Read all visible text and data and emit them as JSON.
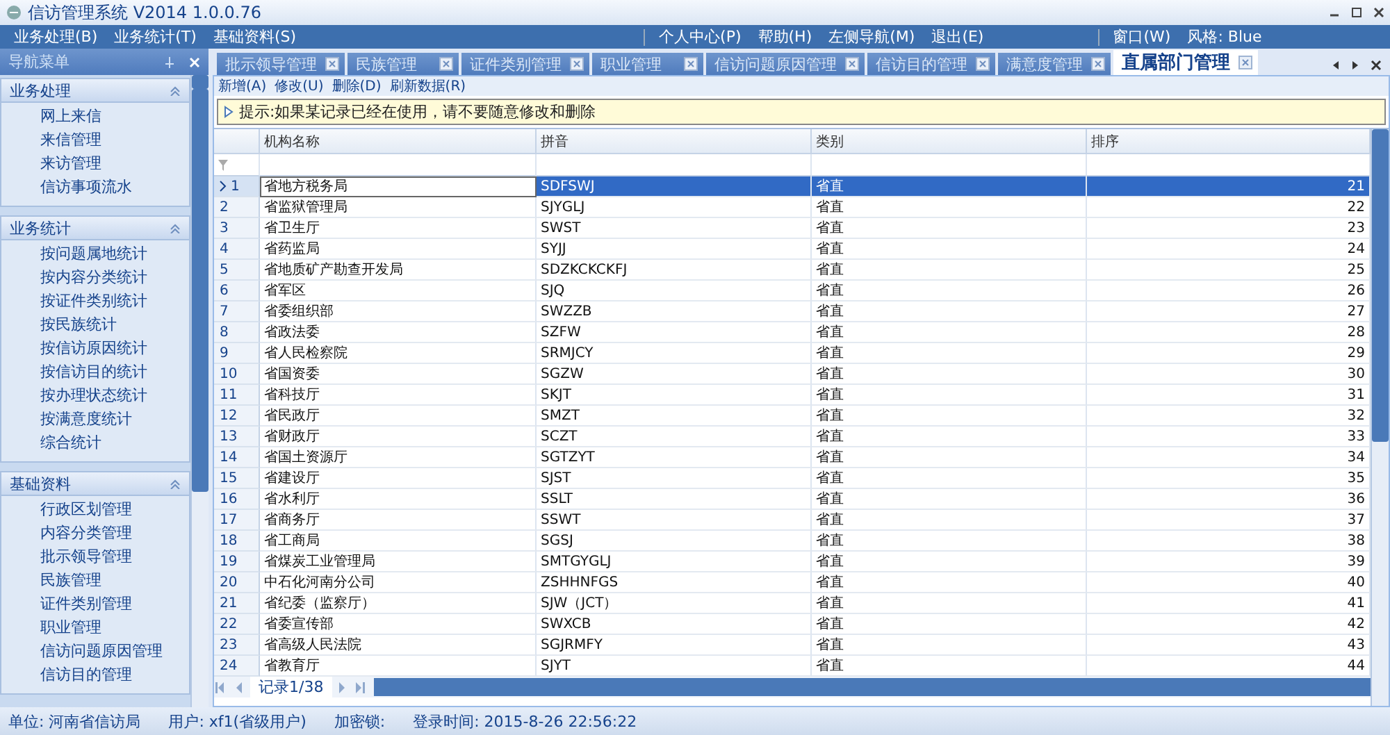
{
  "window": {
    "title": "信访管理系统 V2014 1.0.0.76"
  },
  "menu": {
    "left": [
      "业务处理(B)",
      "业务统计(T)",
      "基础资料(S)"
    ],
    "right": [
      "个人中心(P)",
      "帮助(H)",
      "左侧导航(M)",
      "退出(E)"
    ],
    "extra": [
      "窗口(W)",
      "风格: Blue"
    ]
  },
  "sidebar": {
    "title": "导航菜单",
    "groups": [
      {
        "title": "业务处理",
        "expanded": true,
        "items": [
          "网上来信",
          "来信管理",
          "来访管理",
          "信访事项流水"
        ]
      },
      {
        "title": "业务统计",
        "expanded": true,
        "items": [
          "按问题属地统计",
          "按内容分类统计",
          "按证件类别统计",
          "按民族统计",
          "按信访原因统计",
          "按信访目的统计",
          "按办理状态统计",
          "按满意度统计",
          "综合统计"
        ]
      },
      {
        "title": "基础资料",
        "expanded": true,
        "items": [
          "行政区划管理",
          "内容分类管理",
          "批示领导管理",
          "民族管理",
          "证件类别管理",
          "职业管理",
          "信访问题原因管理",
          "信访目的管理"
        ]
      }
    ]
  },
  "tabs": [
    {
      "label": "批示领导管理",
      "selected": false
    },
    {
      "label": "民族管理",
      "selected": false
    },
    {
      "label": "证件类别管理",
      "selected": false
    },
    {
      "label": "职业管理",
      "selected": false
    },
    {
      "label": "信访问题原因管理",
      "selected": false
    },
    {
      "label": "信访目的管理",
      "selected": false
    },
    {
      "label": "满意度管理",
      "selected": false
    },
    {
      "label": "直属部门管理",
      "selected": true
    }
  ],
  "toolbar": [
    "新增(A)",
    "修改(U)",
    "删除(D)",
    "刷新数据(R)"
  ],
  "hint": "提示:如果某记录已经在使用，请不要随意修改和删除",
  "table": {
    "columns": [
      "机构名称",
      "拼音",
      "类别",
      "排序"
    ],
    "rows": [
      {
        "num": "1",
        "selected": true,
        "cells": [
          "省地方税务局",
          "SDFSWJ",
          "省直",
          "21"
        ]
      },
      {
        "num": "2",
        "selected": false,
        "cells": [
          "省监狱管理局",
          "SJYGLJ",
          "省直",
          "22"
        ]
      },
      {
        "num": "3",
        "selected": false,
        "cells": [
          "省卫生厅",
          "SWST",
          "省直",
          "23"
        ]
      },
      {
        "num": "4",
        "selected": false,
        "cells": [
          "省药监局",
          "SYJJ",
          "省直",
          "24"
        ]
      },
      {
        "num": "5",
        "selected": false,
        "cells": [
          "省地质矿产勘查开发局",
          "SDZKCKCKFJ",
          "省直",
          "25"
        ]
      },
      {
        "num": "6",
        "selected": false,
        "cells": [
          "省军区",
          "SJQ",
          "省直",
          "26"
        ]
      },
      {
        "num": "7",
        "selected": false,
        "cells": [
          "省委组织部",
          "SWZZB",
          "省直",
          "27"
        ]
      },
      {
        "num": "8",
        "selected": false,
        "cells": [
          "省政法委",
          "SZFW",
          "省直",
          "28"
        ]
      },
      {
        "num": "9",
        "selected": false,
        "cells": [
          "省人民检察院",
          "SRMJCY",
          "省直",
          "29"
        ]
      },
      {
        "num": "10",
        "selected": false,
        "cells": [
          "省国资委",
          "SGZW",
          "省直",
          "30"
        ]
      },
      {
        "num": "11",
        "selected": false,
        "cells": [
          "省科技厅",
          "SKJT",
          "省直",
          "31"
        ]
      },
      {
        "num": "12",
        "selected": false,
        "cells": [
          "省民政厅",
          "SMZT",
          "省直",
          "32"
        ]
      },
      {
        "num": "13",
        "selected": false,
        "cells": [
          "省财政厅",
          "SCZT",
          "省直",
          "33"
        ]
      },
      {
        "num": "14",
        "selected": false,
        "cells": [
          "省国土资源厅",
          "SGTZYT",
          "省直",
          "34"
        ]
      },
      {
        "num": "15",
        "selected": false,
        "cells": [
          "省建设厅",
          "SJST",
          "省直",
          "35"
        ]
      },
      {
        "num": "16",
        "selected": false,
        "cells": [
          "省水利厅",
          "SSLT",
          "省直",
          "36"
        ]
      },
      {
        "num": "17",
        "selected": false,
        "cells": [
          "省商务厅",
          "SSWT",
          "省直",
          "37"
        ]
      },
      {
        "num": "18",
        "selected": false,
        "cells": [
          "省工商局",
          "SGSJ",
          "省直",
          "38"
        ]
      },
      {
        "num": "19",
        "selected": false,
        "cells": [
          "省煤炭工业管理局",
          "SMTGYGLJ",
          "省直",
          "39"
        ]
      },
      {
        "num": "20",
        "selected": false,
        "cells": [
          "中石化河南分公司",
          "ZSHHNFGS",
          "省直",
          "40"
        ]
      },
      {
        "num": "21",
        "selected": false,
        "cells": [
          "省纪委（监察厅）",
          "SJW（JCT）",
          "省直",
          "41"
        ]
      },
      {
        "num": "22",
        "selected": false,
        "cells": [
          "省委宣传部",
          "SWXCB",
          "省直",
          "42"
        ]
      },
      {
        "num": "23",
        "selected": false,
        "cells": [
          "省高级人民法院",
          "SGJRMFY",
          "省直",
          "43"
        ]
      },
      {
        "num": "24",
        "selected": false,
        "cells": [
          "省教育厅",
          "SJYT",
          "省直",
          "44"
        ]
      }
    ]
  },
  "pager": {
    "record": "记录1/38"
  },
  "status_bar": [
    "单位: 河南省信访局",
    "用户: xf1(省级用户)",
    "加密锁:",
    "登录时间: 2015-8-26 22:56:22"
  ]
}
